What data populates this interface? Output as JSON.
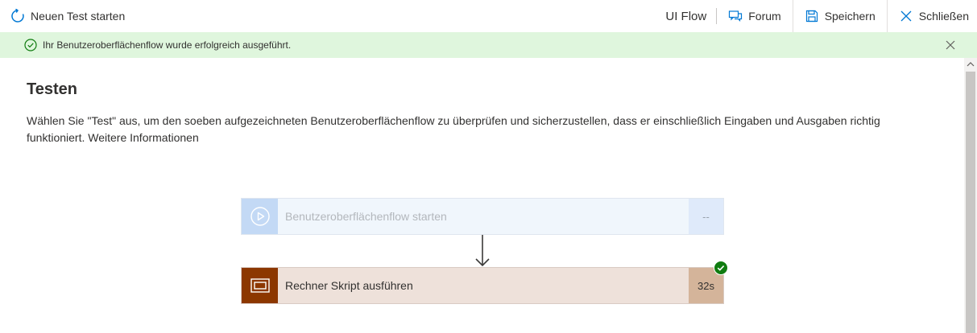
{
  "toolbar": {
    "new_test_label": "Neuen Test starten",
    "app_name": "UI Flow",
    "forum_label": "Forum",
    "save_label": "Speichern",
    "close_label": "Schließen"
  },
  "notification": {
    "message": "Ihr Benutzeroberflächenflow wurde erfolgreich ausgeführt.",
    "status": "success",
    "color": "#dff6dd"
  },
  "main": {
    "title": "Testen",
    "description": "Wählen Sie \"Test\" aus, um den soeben aufgezeichneten Benutzeroberflächenflow zu überprüfen und sicherzustellen, dass er einschließlich Eingaben und Ausgaben richtig funktioniert. Weitere Informationen"
  },
  "flow": {
    "steps": [
      {
        "label": "Benutzeroberflächenflow starten",
        "duration": "--",
        "icon": "play-circle-icon",
        "state": "disabled"
      },
      {
        "label": "Rechner Skript ausführen",
        "duration": "32s",
        "icon": "window-icon",
        "state": "succeeded",
        "accent": "#8c3700"
      }
    ]
  },
  "icons": {
    "new_test": "refresh-icon",
    "forum": "chat-icon",
    "save": "save-icon",
    "close": "close-icon",
    "success": "check-circle-icon",
    "dismiss": "dismiss-icon"
  },
  "colors": {
    "accent_blue": "#0078d4",
    "success_green": "#107c10",
    "step_brown": "#8c3700"
  }
}
